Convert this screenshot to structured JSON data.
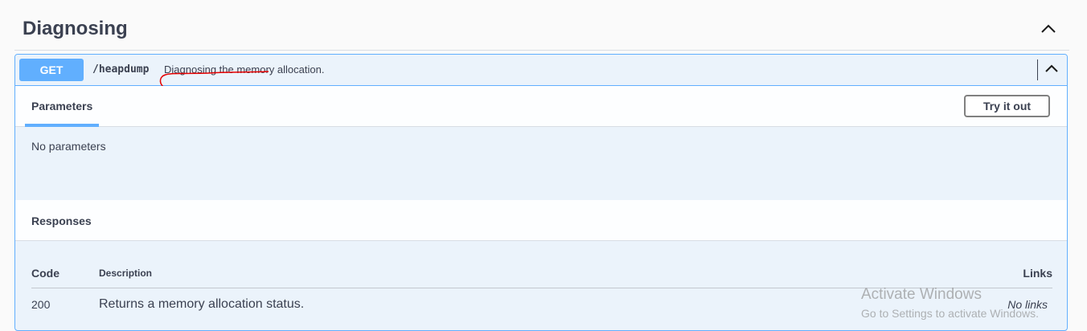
{
  "tag": {
    "title": "Diagnosing",
    "toggle_icon": "chevron-up-icon"
  },
  "operation": {
    "method": "GET",
    "path": "/heapdump",
    "summary": "Diagnosing the memory allocation.",
    "method_color": "#61afFE",
    "toggle_icon": "chevron-up-icon"
  },
  "parameters": {
    "tab_label": "Parameters",
    "try_it_out_label": "Try it out",
    "empty_text": "No parameters"
  },
  "responses": {
    "title": "Responses",
    "columns": {
      "code": "Code",
      "description": "Description",
      "links": "Links"
    },
    "rows": [
      {
        "code": "200",
        "description": "Returns a memory allocation status.",
        "links": "No links"
      }
    ]
  },
  "watermark": {
    "line1": "Activate Windows",
    "line2": "Go to Settings to activate Windows."
  },
  "colors": {
    "accent": "#61affe",
    "panel_bg": "#ebf3fb",
    "annotation": "#e60000"
  }
}
